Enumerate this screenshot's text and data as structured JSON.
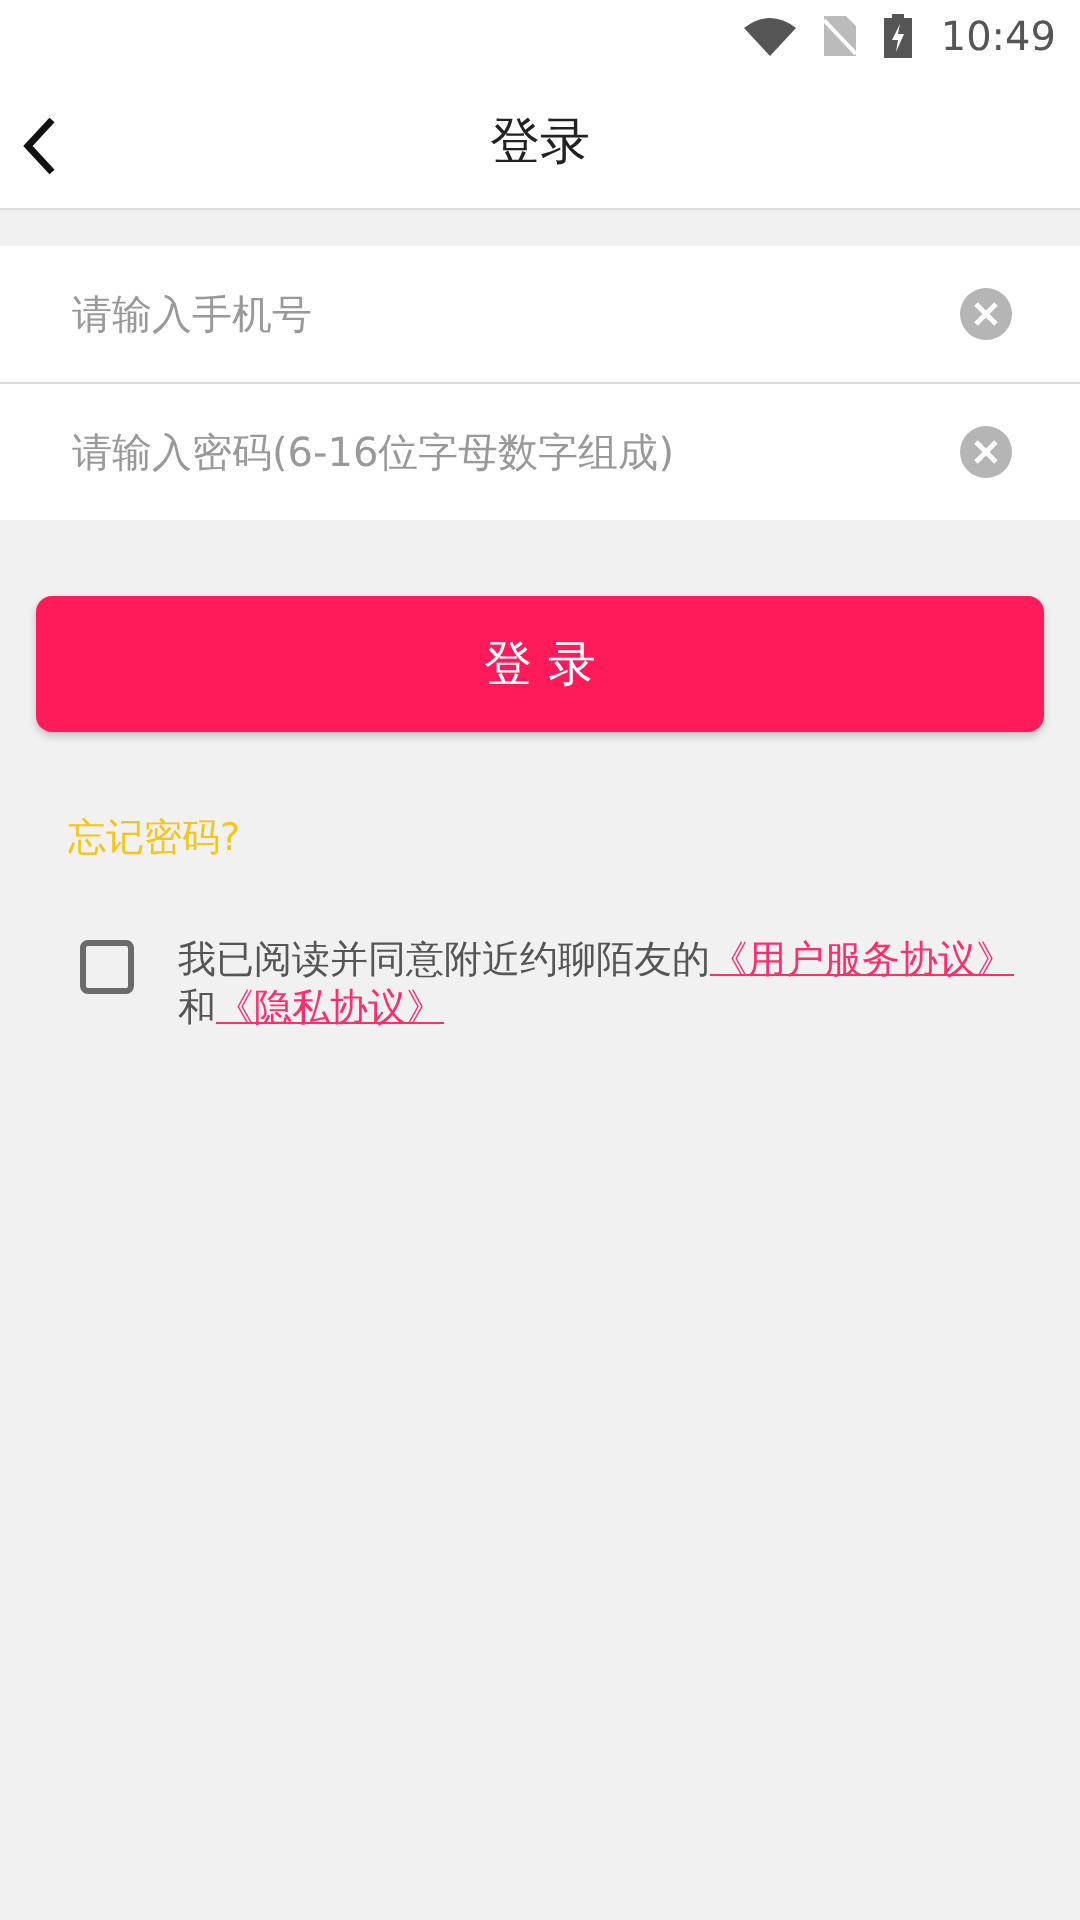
{
  "status_bar": {
    "time": "10:49"
  },
  "header": {
    "title": "登录"
  },
  "fields": [
    {
      "placeholder": "请输入手机号"
    },
    {
      "placeholder": "请输入密码(6-16位字母数字组成)"
    }
  ],
  "login_button": "登 录",
  "forgot_link": "忘记密码?",
  "agreement": {
    "checked": false,
    "text": "我已阅读并同意附近约聊陌友的",
    "links": [
      "《用户服务协议》",
      "《隐私协议》"
    ],
    "joiner": "和"
  }
}
